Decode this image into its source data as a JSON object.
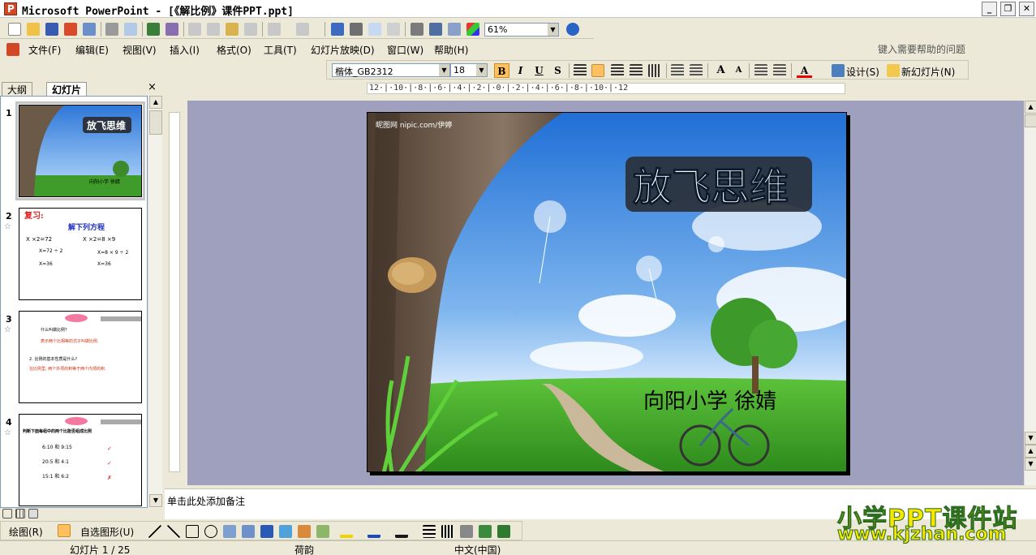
{
  "window": {
    "title": "Microsoft PowerPoint - [《解比例》课件PPT.ppt]"
  },
  "standard_toolbar": {
    "zoom": "61%"
  },
  "menu": {
    "items": [
      "文件(F)",
      "编辑(E)",
      "视图(V)",
      "插入(I)",
      "格式(O)",
      "工具(T)",
      "幻灯片放映(D)",
      "窗口(W)",
      "帮助(H)"
    ],
    "help_placeholder": "键入需要帮助的问题"
  },
  "format_toolbar": {
    "font": "楷体_GB2312",
    "size": "18",
    "bold": "B",
    "italic": "I",
    "underline": "U",
    "shadow": "S",
    "design_label": "设计(S)",
    "new_slide_label": "新幻灯片(N)"
  },
  "outline_panel": {
    "tab_outline": "大纲",
    "tab_slides": "幻灯片",
    "close": "×",
    "thumbnails": [
      {
        "num": "1",
        "title": "放飞思维",
        "subtitle": "向阳小学 徐婧"
      },
      {
        "num": "2",
        "title": "复习:",
        "heading": "解下列方程",
        "lines": [
          "X ×2=72",
          "X ×2=8 ×9",
          "X=72 ÷ 2",
          "X=8 × 9 ÷ 2",
          "X=36",
          "X=36"
        ]
      },
      {
        "num": "3",
        "lines": [
          "什么叫做比例?",
          "表示两个比相等的式子叫做比例.",
          "2. 比例的基本性质是什么?",
          "在比例里, 两个外项的积等于两个内项的积."
        ]
      },
      {
        "num": "4",
        "lines": [
          "判断下面每组中的两个比能否组成比例",
          "6:10 和 9:15",
          "20:5 和 4:1",
          "15:1 和 6:2"
        ]
      }
    ]
  },
  "ruler": {
    "horizontal": "12·|·10·|·8·|·6·|·4·|·2·|·0·|·2·|·4·|·6·|·8·|·10·|·12"
  },
  "slide": {
    "watermark": "昵图网 nipic.com/伊婷",
    "title": "放飞思维",
    "subtitle": "向阳小学   徐婧"
  },
  "notes": {
    "placeholder": "单击此处添加备注"
  },
  "drawing_toolbar": {
    "draw_label": "绘图(R)",
    "autoshapes_label": "自选图形(U)"
  },
  "status": {
    "slide_counter": "幻灯片 1 / 25",
    "design": "荷韵",
    "language": "中文(中国)"
  },
  "site_watermark": {
    "line1": "小学PPT课件站",
    "line2": "www.kjzhan.com"
  },
  "colors": {
    "accent_orange": "#ffc060",
    "sky": "#4a8fd8",
    "grass": "#3c9a28",
    "canvas": "#9fa0be"
  }
}
